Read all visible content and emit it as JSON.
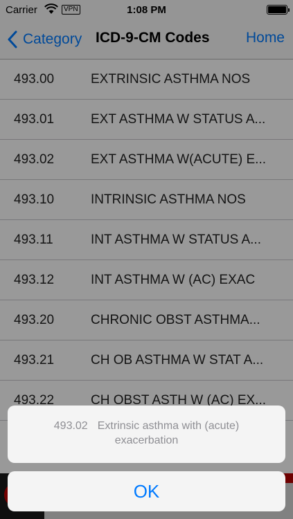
{
  "status_bar": {
    "carrier": "Carrier",
    "vpn": "VPN",
    "time": "1:08 PM"
  },
  "nav": {
    "back_label": "Category",
    "title": "ICD-9-CM Codes",
    "home_label": "Home"
  },
  "rows": [
    {
      "code": "493.00",
      "desc": "EXTRINSIC ASTHMA NOS"
    },
    {
      "code": "493.01",
      "desc": "EXT ASTHMA W STATUS A..."
    },
    {
      "code": "493.02",
      "desc": "EXT ASTHMA W(ACUTE) E..."
    },
    {
      "code": "493.10",
      "desc": "INTRINSIC ASTHMA NOS"
    },
    {
      "code": "493.11",
      "desc": "INT ASTHMA W STATUS A..."
    },
    {
      "code": "493.12",
      "desc": "INT ASTHMA W (AC) EXAC"
    },
    {
      "code": "493.20",
      "desc": "CHRONIC OBST ASTHMA..."
    },
    {
      "code": "493.21",
      "desc": "CH OB ASTHMA W STAT A..."
    },
    {
      "code": "493.22",
      "desc": "CH OBST ASTH W (AC) EX..."
    }
  ],
  "action_sheet": {
    "code": "493.02",
    "message_line1": "Extrinsic asthma with (acute)",
    "message_line2": "exacerbation",
    "ok_label": "OK"
  },
  "colors": {
    "accent": "#007aff",
    "overlay": "rgba(0,0,0,0.40)"
  }
}
